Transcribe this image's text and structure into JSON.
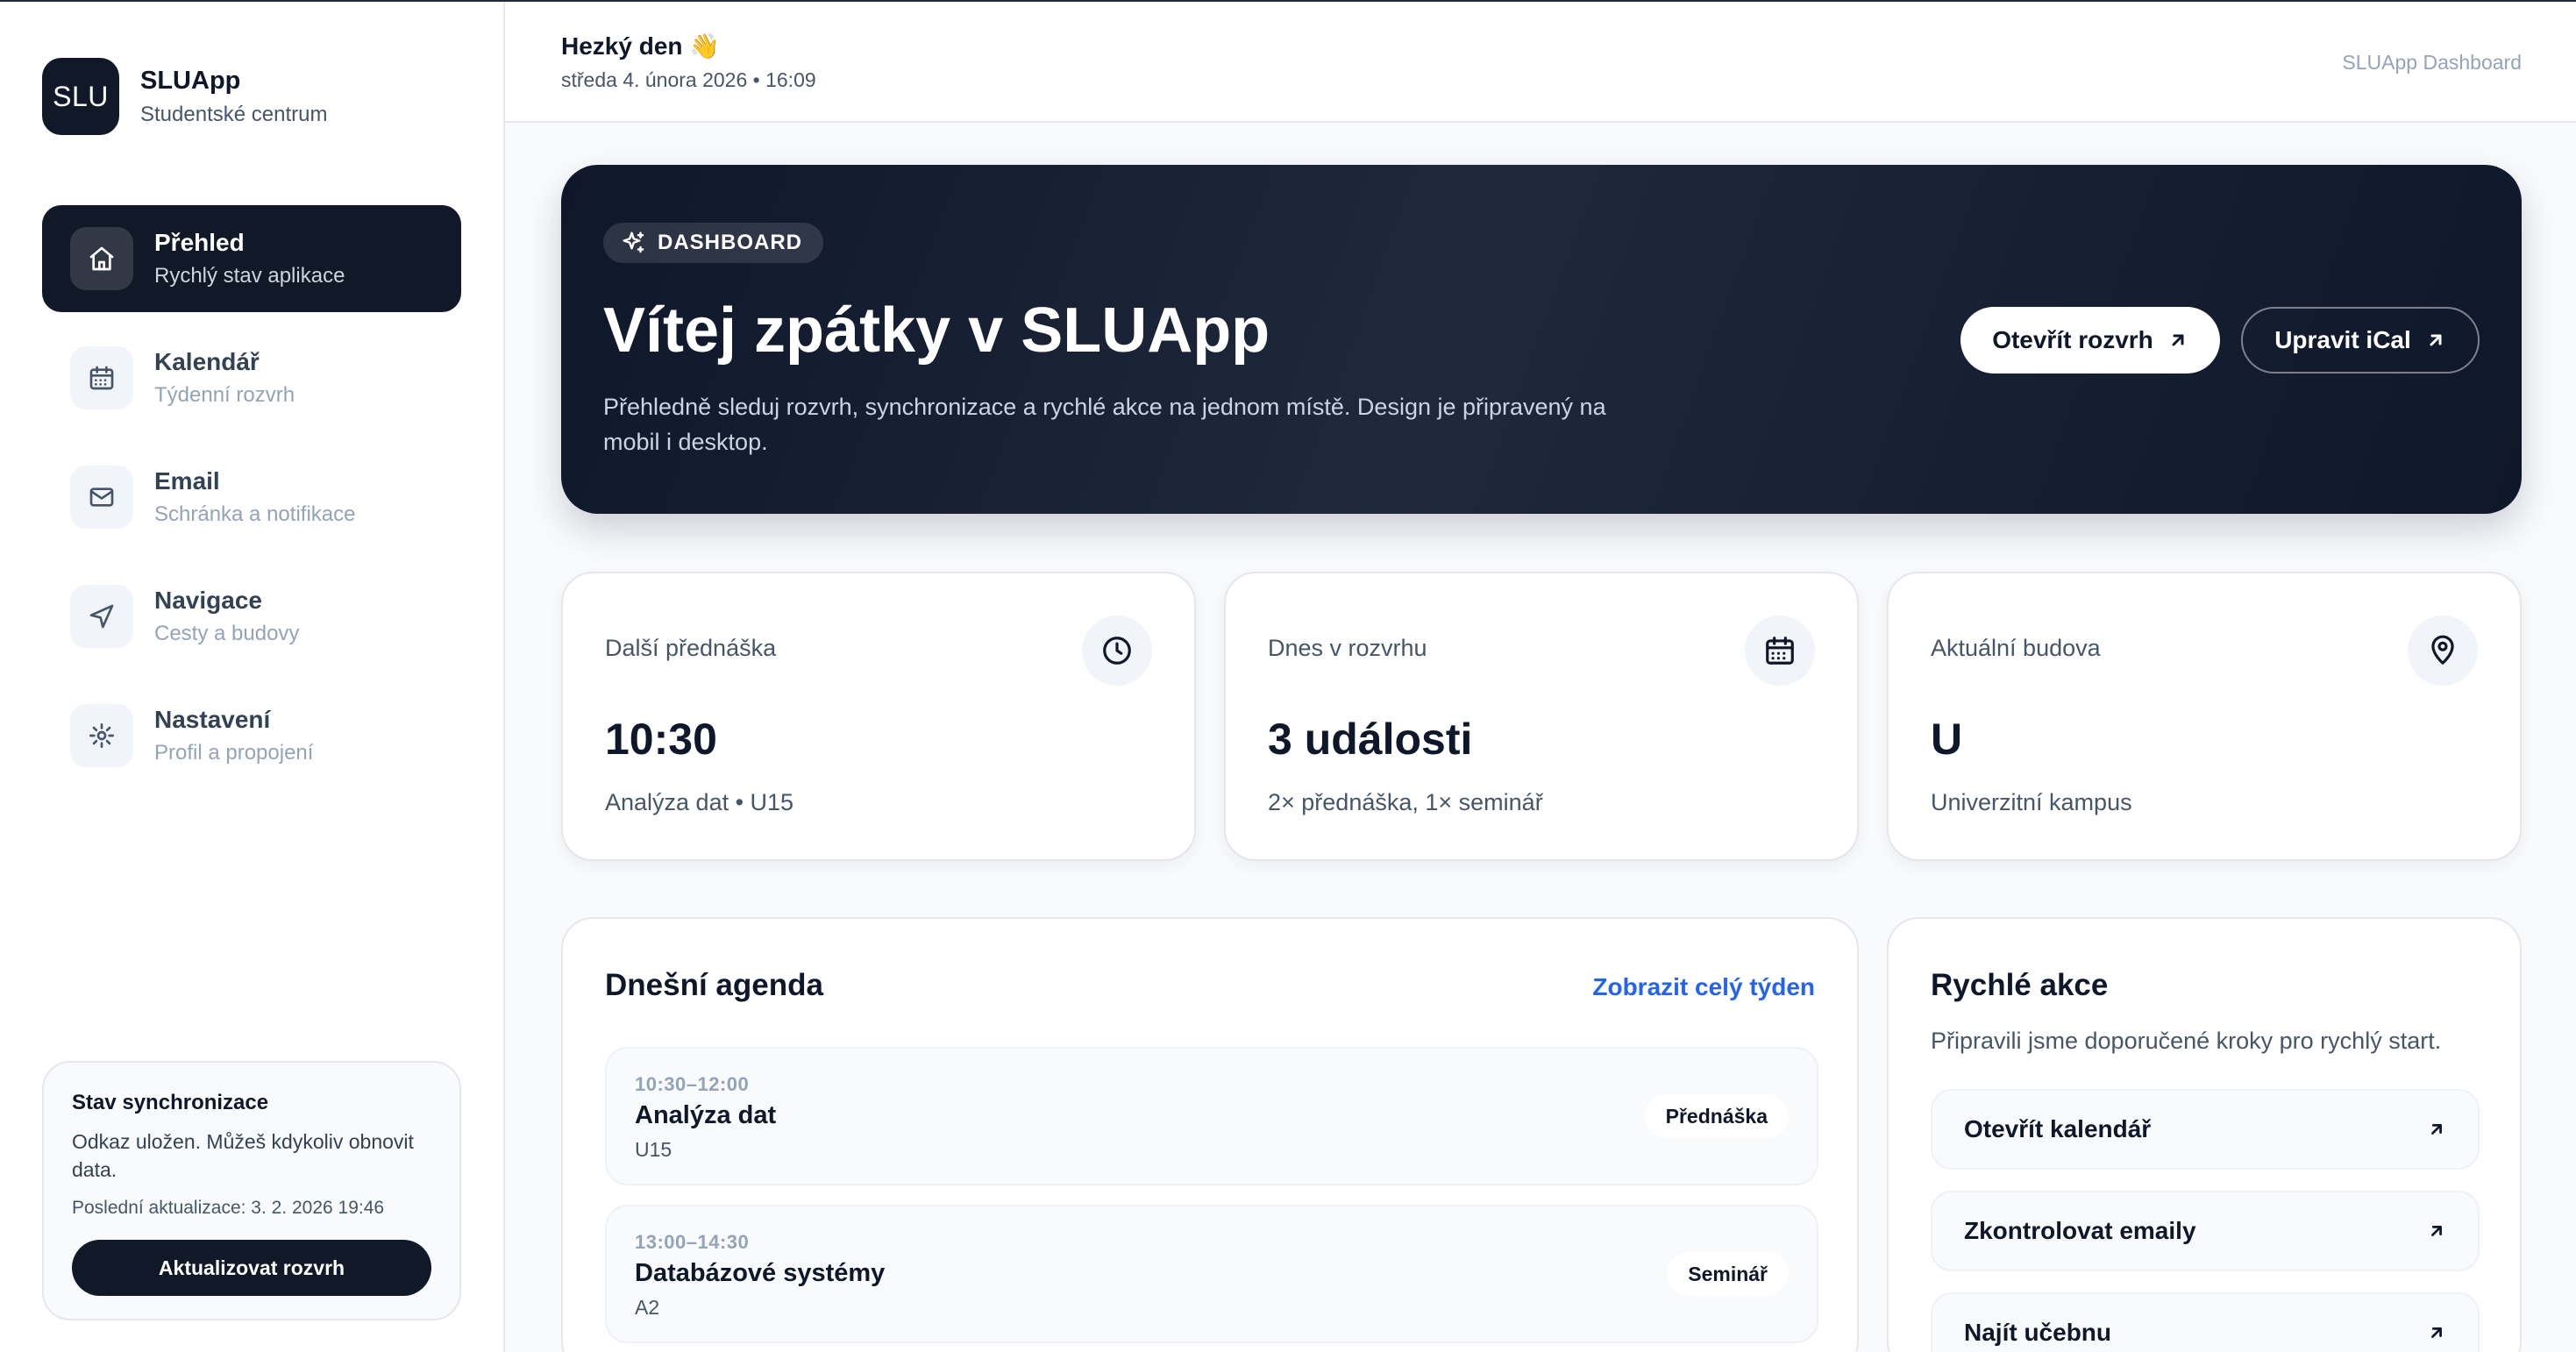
{
  "brand": {
    "logo": "SLU",
    "name": "SLUApp",
    "subtitle": "Studentské centrum"
  },
  "nav": {
    "items": [
      {
        "label": "Přehled",
        "sub": "Rychlý stav aplikace",
        "icon": "home-icon",
        "active": true
      },
      {
        "label": "Kalendář",
        "sub": "Týdenní rozvrh",
        "icon": "calendar-icon",
        "active": false
      },
      {
        "label": "Email",
        "sub": "Schránka a notifikace",
        "icon": "mail-icon",
        "active": false
      },
      {
        "label": "Navigace",
        "sub": "Cesty a budovy",
        "icon": "navigation-icon",
        "active": false
      },
      {
        "label": "Nastavení",
        "sub": "Profil a propojení",
        "icon": "gear-icon",
        "active": false
      }
    ]
  },
  "sync": {
    "title": "Stav synchronizace",
    "text": "Odkaz uložen. Můžeš kdykoliv obnovit data.",
    "last_update": "Poslední aktualizace: 3. 2. 2026 19:46",
    "button": "Aktualizovat rozvrh"
  },
  "header": {
    "greeting": "Hezký den",
    "greeting_emoji": "👋",
    "date": "středa 4. února 2026 • 16:09",
    "right_label": "SLUApp Dashboard"
  },
  "hero": {
    "badge": "DASHBOARD",
    "title": "Vítej zpátky v SLUApp",
    "description": "Přehledně sleduj rozvrh, synchronizace a rychlé akce na jednom místě. Design je připravený na mobil i desktop.",
    "primary_button": "Otevřít rozvrh",
    "secondary_button": "Upravit iCal"
  },
  "stats": [
    {
      "label": "Další přednáška",
      "value": "10:30",
      "sub": "Analýza dat • U15",
      "icon": "clock-icon"
    },
    {
      "label": "Dnes v rozvrhu",
      "value": "3 události",
      "sub": "2× přednáška, 1× seminář",
      "icon": "calendar-icon"
    },
    {
      "label": "Aktuální budova",
      "value": "U",
      "sub": "Univerzitní kampus",
      "icon": "map-pin-icon"
    }
  ],
  "agenda": {
    "title": "Dnešní agenda",
    "link": "Zobrazit celý týden",
    "events": [
      {
        "time": "10:30–12:00",
        "name": "Analýza dat",
        "room": "U15",
        "type": "Přednáška"
      },
      {
        "time": "13:00–14:30",
        "name": "Databázové systémy",
        "room": "A2",
        "type": "Seminář"
      }
    ]
  },
  "quick_actions": {
    "title": "Rychlé akce",
    "subtitle": "Připravili jsme doporučené kroky pro rychlý start.",
    "items": [
      {
        "label": "Otevřít kalendář"
      },
      {
        "label": "Zkontrolovat emaily"
      },
      {
        "label": "Najít učebnu"
      }
    ]
  },
  "colors": {
    "accent_dark": "#111827",
    "link_blue": "#2563eb",
    "background": "#f8fafc"
  }
}
